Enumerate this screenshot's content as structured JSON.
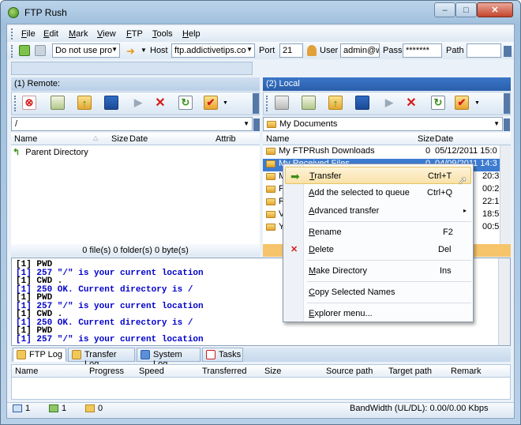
{
  "window": {
    "title": "FTP Rush",
    "min": "–",
    "max": "□",
    "close": "✕"
  },
  "menu": [
    "File",
    "Edit",
    "Mark",
    "View",
    "FTP",
    "Tools",
    "Help"
  ],
  "connection": {
    "proxy": "Do not use pro",
    "host_label": "Host",
    "host": "ftp.addictivetips.co",
    "port_label": "Port",
    "port": "21",
    "user_label": "User",
    "user": "admin@w",
    "pass_label": "Pass",
    "pass": "*******",
    "path_label": "Path",
    "path": ""
  },
  "left_pane": {
    "header": "(1) Remote:",
    "path": "/",
    "columns": [
      "Name",
      "Size",
      "Date",
      "Attrib"
    ],
    "rows": [
      {
        "name": "Parent Directory"
      }
    ],
    "status": "0 file(s) 0 folder(s) 0 byte(s)"
  },
  "right_pane": {
    "header": "(2) Local",
    "path": "My Documents",
    "columns": [
      "Name",
      "Size",
      "Date"
    ],
    "rows": [
      {
        "name": "My FTPRush Downloads",
        "size": "0",
        "date": "05/12/2011 15:0"
      },
      {
        "name": "My Received Files",
        "size": "0",
        "date": "04/09/2011 14:3"
      },
      {
        "name": "M",
        "size": "",
        "date": "20:3"
      },
      {
        "name": "P",
        "size": "",
        "date": "00:2"
      },
      {
        "name": "R",
        "size": "",
        "date": "22:1"
      },
      {
        "name": "V",
        "size": "",
        "date": "18:5"
      },
      {
        "name": "Y",
        "size": "",
        "date": "00:5"
      }
    ]
  },
  "context_menu": [
    {
      "label": "Transfer",
      "key": "Ctrl+T"
    },
    {
      "label": "Add the selected to queue",
      "key": "Ctrl+Q"
    },
    {
      "label": "Advanced transfer",
      "key": "▸"
    },
    {
      "label": "Rename",
      "key": "F2"
    },
    {
      "label": "Delete",
      "key": "Del"
    },
    {
      "label": "Make Directory",
      "key": "Ins"
    },
    {
      "label": "Copy Selected Names",
      "key": ""
    },
    {
      "label": "Explorer menu...",
      "key": ""
    }
  ],
  "log": [
    "[1] PWD",
    "[1] 257 \"/\" is your current location",
    "[1] CWD .",
    "[1] 250 OK. Current directory is /",
    "[1] PWD",
    "[1] 257 \"/\" is your current location",
    "[1] CWD .",
    "[1] 250 OK. Current directory is /",
    "[1] PWD",
    "[1] 257 \"/\" is your current location"
  ],
  "tabs": [
    "FTP Log",
    "Transfer Log",
    "System Log",
    "Tasks"
  ],
  "queue_columns": [
    "Name",
    "Progress",
    "Speed",
    "Transferred",
    "Size",
    "Source path",
    "Target path",
    "Remark"
  ],
  "statusbar": {
    "a": "1",
    "b": "1",
    "c": "0",
    "bandwidth": "BandWidth (UL/DL): 0.00/0.00 Kbps"
  },
  "colors": {
    "local_header": "#2a5ea9",
    "log_text": "#0000cc",
    "delete_red": "#d41c1c"
  }
}
